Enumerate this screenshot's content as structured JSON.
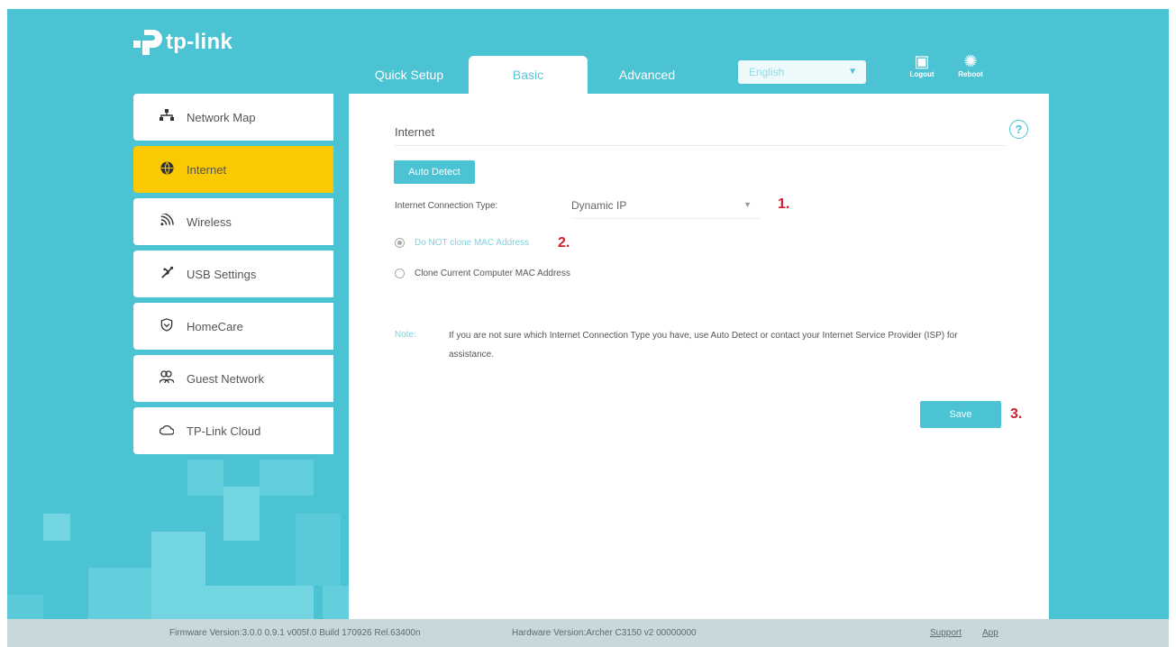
{
  "brand": {
    "name": "tp-link"
  },
  "tabs": [
    {
      "label": "Quick Setup",
      "active": false
    },
    {
      "label": "Basic",
      "active": true
    },
    {
      "label": "Advanced",
      "active": false
    }
  ],
  "language": {
    "value": "English"
  },
  "top_actions": {
    "logout": "Logout",
    "reboot": "Reboot"
  },
  "sidebar": {
    "items": [
      {
        "label": "Network Map",
        "icon": "network-map-icon",
        "active": false
      },
      {
        "label": "Internet",
        "icon": "globe-icon",
        "active": true
      },
      {
        "label": "Wireless",
        "icon": "wireless-icon",
        "active": false
      },
      {
        "label": "USB Settings",
        "icon": "usb-icon",
        "active": false
      },
      {
        "label": "HomeCare",
        "icon": "shield-icon",
        "active": false
      },
      {
        "label": "Guest Network",
        "icon": "guest-users-icon",
        "active": false
      },
      {
        "label": "TP-Link Cloud",
        "icon": "cloud-icon",
        "active": false
      }
    ]
  },
  "main": {
    "section_title": "Internet",
    "auto_detect_label": "Auto Detect",
    "connection_type_label": "Internet Connection Type:",
    "connection_type_value": "Dynamic IP",
    "mac_options": [
      {
        "label": "Do NOT clone MAC Address",
        "selected": true
      },
      {
        "label": "Clone Current Computer MAC Address",
        "selected": false
      }
    ],
    "note_label": "Note:",
    "note_text": "If you are not sure which Internet Connection Type you have, use Auto Detect or contact your Internet Service Provider (ISP) for assistance.",
    "save_label": "Save"
  },
  "annotations": {
    "step1": "1.",
    "step2": "2.",
    "step3": "3."
  },
  "footer": {
    "firmware": "Firmware Version:3.0.0 0.9.1 v005f.0 Build 170926 Rel.63400n",
    "hardware": "Hardware Version:Archer C3150 v2 00000000",
    "support": "Support",
    "app": "App"
  },
  "colors": {
    "accent": "#4bc3d3",
    "active_item": "#fbc901",
    "annotation": "#d1202f"
  }
}
